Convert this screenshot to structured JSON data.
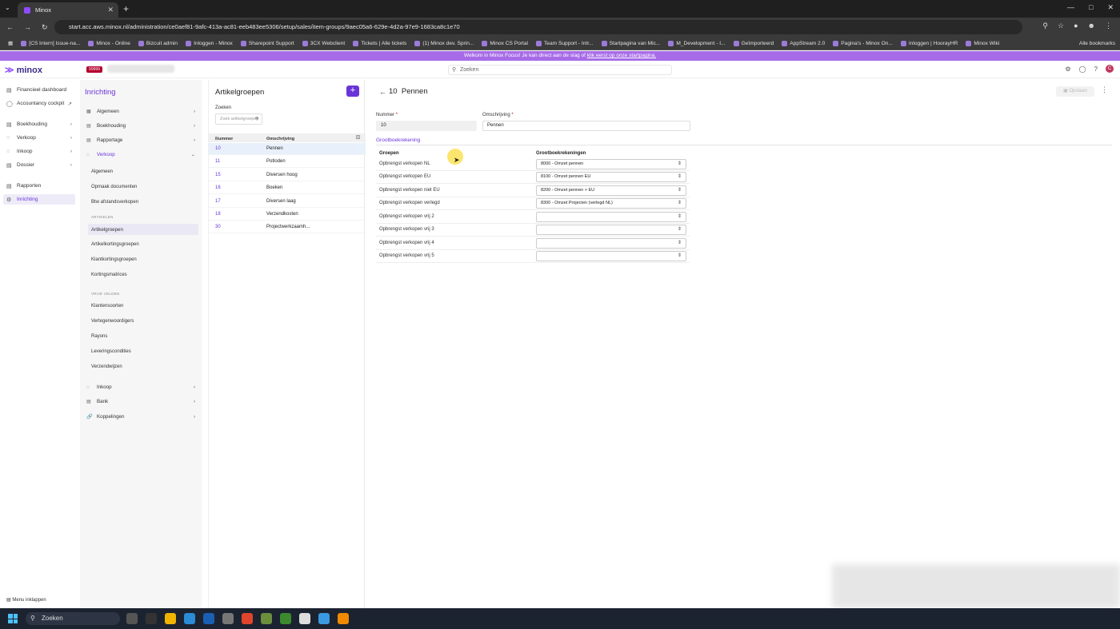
{
  "browser": {
    "tab_title": "Minox",
    "url": "start.acc.aws.minox.nl/administration/ce0aef81-9afc-413a-ac81-eeb483ee5306/setup/sales/item-groups/9aec05a6-629e-4d2a-97e9-1683ca8c1e70",
    "bookmarks": [
      "[CS Intern] Issue-na...",
      "Minox - Online",
      "Bizcuit admin",
      "Inloggen - Minox",
      "Sharepoint Support",
      "3CX Webclient",
      "Tickets | Alle tickets",
      "(1) Minox dev. Sprin...",
      "Minox CS Portal",
      "Team Support - Intr...",
      "Startpagina van Mic...",
      "M_Development - I...",
      "Geïmporteerd",
      "AppStream 2.0",
      "Pagina's - Minox On...",
      "Inloggen | HoorayHR",
      "Minox Wiki"
    ],
    "all_bookmarks": "Alle bookmarks"
  },
  "banner": {
    "text": "Welkom in Minox Focus! Je kan direct aan de slag of ",
    "link": "klik eerst op onze startpagina."
  },
  "header": {
    "logo": "minox",
    "badge": "99999",
    "search_placeholder": "Zoeken",
    "avatar": "C"
  },
  "leftnav": {
    "items": [
      {
        "label": "Financieel dashboard"
      },
      {
        "label": "Accountancy cockpit"
      },
      {
        "label": "Boekhouding"
      },
      {
        "label": "Verkoop"
      },
      {
        "label": "Inkoop"
      },
      {
        "label": "Dossier"
      },
      {
        "label": "Rapporten"
      },
      {
        "label": "Inrichting"
      }
    ],
    "bottom": "Menu inklappen"
  },
  "setup": {
    "title": "Inrichting",
    "items": [
      "Algemeen",
      "Boekhouding",
      "Rapportage",
      "Verkoop",
      "Inkoop",
      "Bank",
      "Koppelingen"
    ],
    "sub_verkoop": [
      "Algemeen",
      "Opmaak documenten",
      "Btw afstandsverkopen"
    ],
    "section_artikelen": "ARTIKELEN",
    "sub_artikelen": [
      "Artikelgroepen",
      "Artikelkortingsgroepen",
      "Klantkortingsgroepen",
      "Kortingsmatrices"
    ],
    "section_vrije": "VRIJE VELDEN",
    "sub_vrije": [
      "Klantensoorten",
      "Vertegenwoordigers",
      "Rayons",
      "Leveringscondities",
      "Verzendwijzen"
    ]
  },
  "list": {
    "title": "Artikelgroepen",
    "search_label": "Zoeken",
    "search_placeholder": "Zoek artikelgroepen",
    "col_nummer": "Nummer",
    "col_omschrijving": "Omschrijving",
    "rows": [
      {
        "n": "10",
        "d": "Pennen"
      },
      {
        "n": "11",
        "d": "Potloden"
      },
      {
        "n": "15",
        "d": "Diversen hoog"
      },
      {
        "n": "16",
        "d": "Boeken"
      },
      {
        "n": "17",
        "d": "Diversen laag"
      },
      {
        "n": "18",
        "d": "Verzendkosten"
      },
      {
        "n": "30",
        "d": "Projectwerkzaamh..."
      }
    ]
  },
  "detail": {
    "num": "10",
    "title": "Pennen",
    "save": "Opslaan",
    "nummer_label": "Nummer",
    "nummer_value": "10",
    "omschrijving_label": "Omschrijving",
    "omschrijving_value": "Pennen",
    "section": "Grootboekrekening",
    "col_groepen": "Groepen",
    "col_gb": "Grootboekrekeningen",
    "rows": [
      {
        "g": "Opbrengst verkopen NL",
        "v": "8000 - Omzet pennen"
      },
      {
        "g": "Opbrengst verkopen EU",
        "v": "8100 - Omzet pennen EU"
      },
      {
        "g": "Opbrengst verkopen niet EU",
        "v": "8200 - Omzet pennen > EU"
      },
      {
        "g": "Opbrengst verkopen verlegd",
        "v": "8300 - Omzet Projecten (verlegd NL)"
      },
      {
        "g": "Opbrengst verkopen vrij 2",
        "v": ""
      },
      {
        "g": "Opbrengst verkopen vrij 3",
        "v": ""
      },
      {
        "g": "Opbrengst verkopen vrij 4",
        "v": ""
      },
      {
        "g": "Opbrengst verkopen vrij 5",
        "v": ""
      }
    ]
  },
  "taskbar": {
    "search": "Zoeken"
  }
}
